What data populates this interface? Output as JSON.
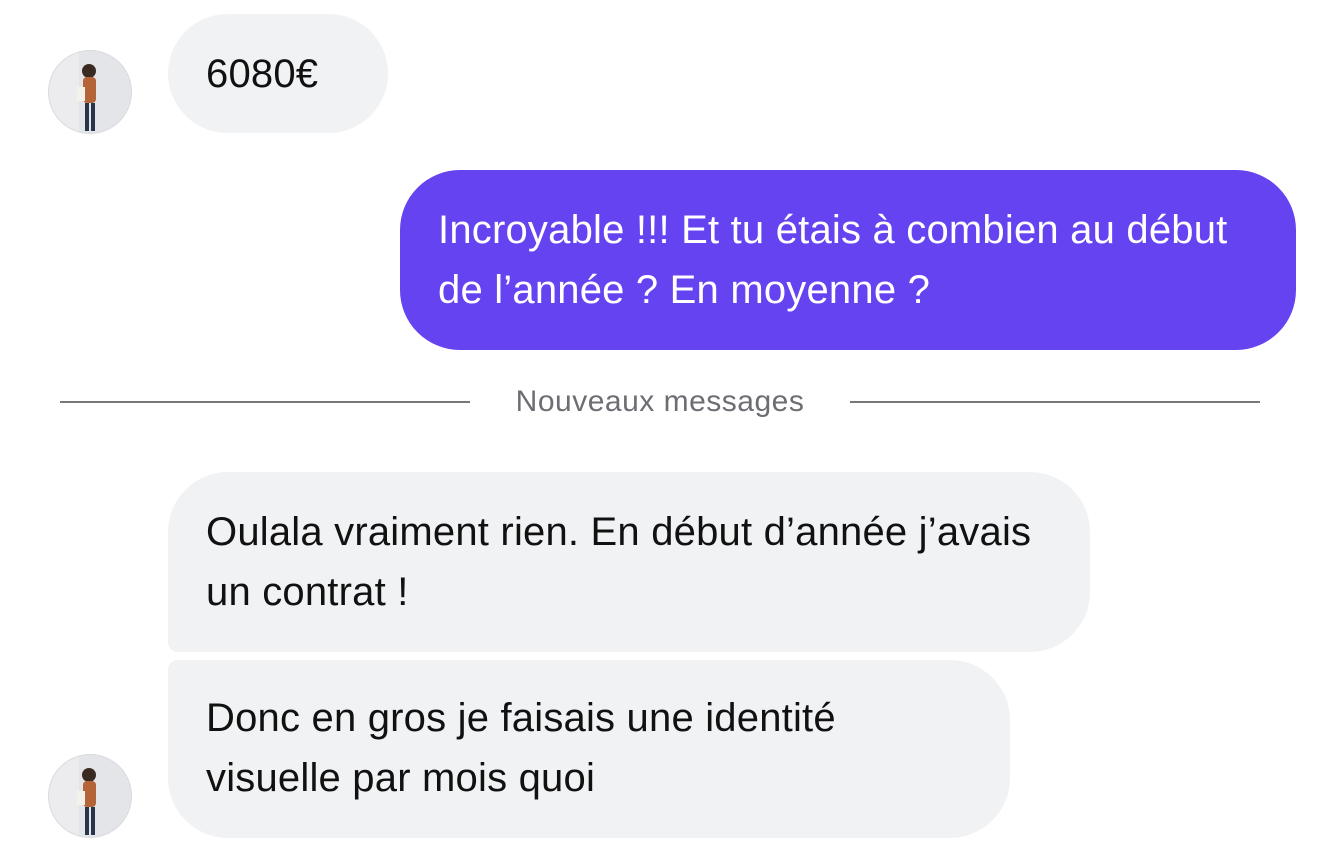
{
  "conversation": {
    "messages": [
      {
        "sender": "contact",
        "text": "6080€"
      },
      {
        "sender": "me",
        "text": "Incroyable !!! Et tu étais à combien au début de l’année ? En moyenne ?"
      },
      {
        "sender": "contact",
        "text": "Oulala vraiment rien. En début d’année j’avais un contrat !"
      },
      {
        "sender": "contact",
        "text": "Donc en gros je faisais une identité visuelle par mois quoi"
      }
    ],
    "divider_label": "Nouveaux messages"
  },
  "colors": {
    "outgoing_bubble": "#6643f0",
    "incoming_bubble": "#f1f2f4",
    "divider": "#76777b"
  },
  "icons": {
    "avatar": "contact-avatar-photo"
  }
}
